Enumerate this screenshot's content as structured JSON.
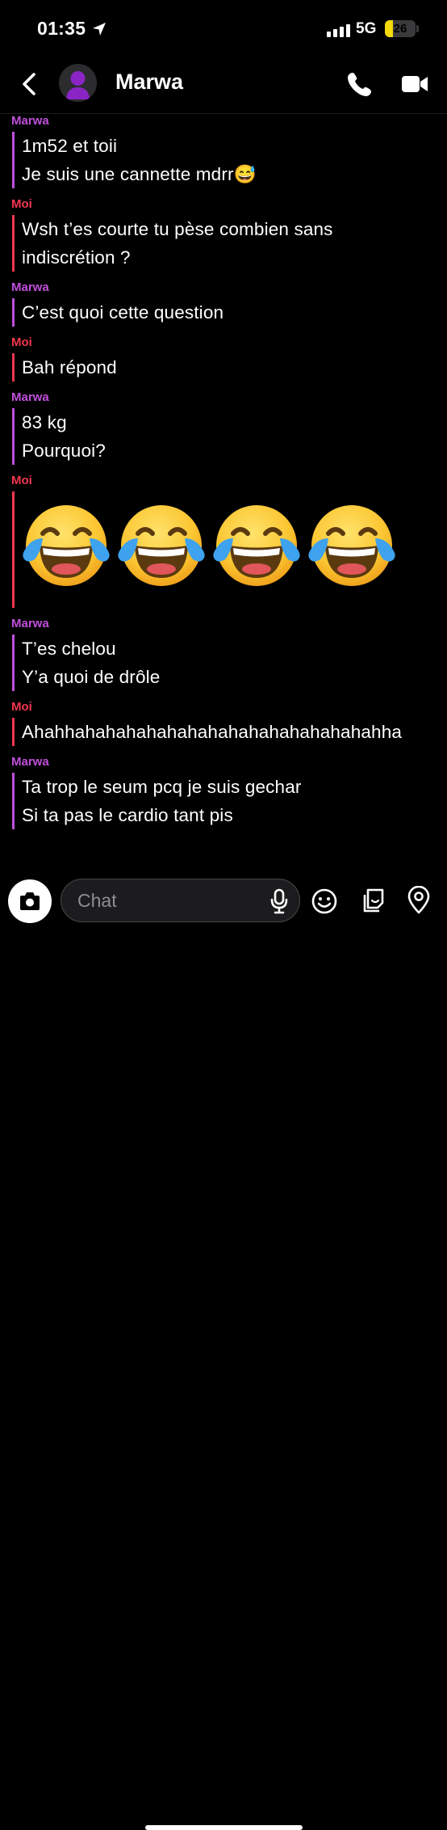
{
  "status_bar": {
    "time": "01:35",
    "network": "5G",
    "battery": "26",
    "battery_level_percent": 26
  },
  "header": {
    "contact_name": "Marwa"
  },
  "messages": [
    {
      "sender": "Marwa",
      "side": "marwa",
      "lines": [
        "1m52 et toii",
        "Je suis une cannette mdrr😅"
      ]
    },
    {
      "sender": "Moi",
      "side": "moi",
      "lines": [
        "Wsh t’es courte tu pèse combien sans",
        "indiscrétion ?"
      ]
    },
    {
      "sender": "Marwa",
      "side": "marwa",
      "lines": [
        "C’est quoi cette question"
      ]
    },
    {
      "sender": "Moi",
      "side": "moi",
      "lines": [
        "Bah répond"
      ]
    },
    {
      "sender": "Marwa",
      "side": "marwa",
      "lines": [
        "83 kg",
        "Pourquoi?"
      ]
    },
    {
      "sender": "Moi",
      "side": "moi",
      "emoji": [
        "😂",
        "😂",
        "😂",
        "😂"
      ]
    },
    {
      "sender": "Marwa",
      "side": "marwa",
      "lines": [
        "T’es chelou",
        "Y’a quoi de drôle"
      ]
    },
    {
      "sender": "Moi",
      "side": "moi",
      "lines": [
        "Ahahhahahahahahahahahahahahahahahahha"
      ]
    },
    {
      "sender": "Marwa",
      "side": "marwa",
      "lines": [
        "Ta trop le seum pcq je suis gechar",
        "Si ta pas le cardio tant pis"
      ]
    }
  ],
  "composer": {
    "placeholder": "Chat"
  },
  "icons": {
    "back": "chevron-left-icon",
    "call": "phone-icon",
    "video": "video-camera-icon",
    "camera": "camera-icon",
    "mic": "microphone-icon",
    "emoji": "smiley-icon",
    "sticker": "sticker-icon",
    "location": "map-pin-icon"
  },
  "colors": {
    "marwa": "#c04fdb",
    "moi": "#f2364e",
    "background": "#000000"
  }
}
